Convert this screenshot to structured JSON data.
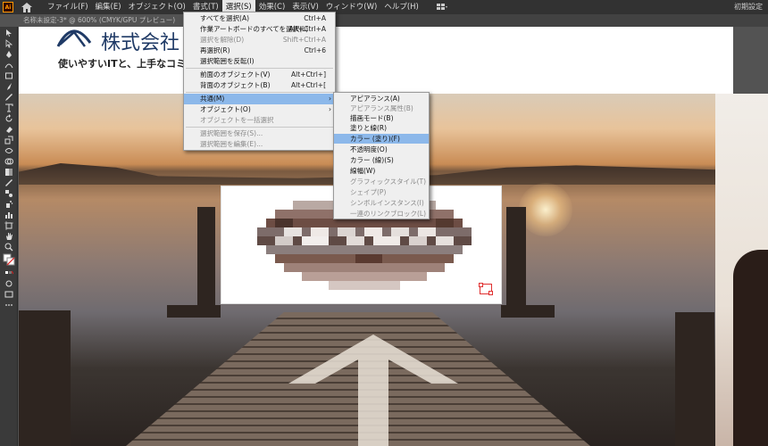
{
  "app": {
    "logo_text": "Ai",
    "workspace": "初期設定"
  },
  "menubar": {
    "items": [
      "ファイル(F)",
      "編集(E)",
      "オブジェクト(O)",
      "書式(T)",
      "選択(S)",
      "効果(C)",
      "表示(V)",
      "ウィンドウ(W)",
      "ヘルプ(H)"
    ],
    "active_index": 4
  },
  "document_tab": {
    "title": "名称未設定-3* @ 600% (CMYK/GPU プレビュー)",
    "close": "×"
  },
  "artboard": {
    "company_name": "株式会社",
    "tagline": "使いやすいITと、上手なコミュ"
  },
  "select_menu": {
    "items": [
      {
        "label": "すべてを選択(A)",
        "shortcut": "Ctrl+A",
        "disabled": false
      },
      {
        "label": "作業アートボードのすべてを選択(L)",
        "shortcut": "Alt+Ctrl+A",
        "disabled": false
      },
      {
        "label": "選択を解除(D)",
        "shortcut": "Shift+Ctrl+A",
        "disabled": true
      },
      {
        "label": "再選択(R)",
        "shortcut": "Ctrl+6",
        "disabled": false
      },
      {
        "label": "選択範囲を反転(I)",
        "shortcut": "",
        "disabled": false
      },
      {
        "label": "前面のオブジェクト(V)",
        "shortcut": "Alt+Ctrl+]",
        "disabled": false
      },
      {
        "label": "背面のオブジェクト(B)",
        "shortcut": "Alt+Ctrl+[",
        "disabled": false
      },
      {
        "label": "共通(M)",
        "shortcut": "",
        "disabled": false,
        "submenu": true
      },
      {
        "label": "オブジェクト(O)",
        "shortcut": "",
        "disabled": false,
        "submenu": true
      },
      {
        "label": "オブジェクトを一括選択",
        "shortcut": "",
        "disabled": true
      },
      {
        "label": "選択範囲を保存(S)...",
        "shortcut": "",
        "disabled": true
      },
      {
        "label": "選択範囲を編集(E)...",
        "shortcut": "",
        "disabled": true
      }
    ],
    "highlight_index": 7
  },
  "common_submenu": {
    "items": [
      {
        "label": "アピアランス(A)",
        "disabled": false
      },
      {
        "label": "アピアランス属性(B)",
        "disabled": true
      },
      {
        "label": "描画モード(B)",
        "disabled": false
      },
      {
        "label": "塗りと線(R)",
        "disabled": false
      },
      {
        "label": "カラー (塗り)(F)",
        "disabled": false
      },
      {
        "label": "不透明度(O)",
        "disabled": false
      },
      {
        "label": "カラー (線)(S)",
        "disabled": false
      },
      {
        "label": "線幅(W)",
        "disabled": false
      },
      {
        "label": "グラフィックスタイル(T)",
        "disabled": true
      },
      {
        "label": "シェイプ(P)",
        "disabled": true
      },
      {
        "label": "シンボルインスタンス(I)",
        "disabled": true
      },
      {
        "label": "一連のリンクブロック(L)",
        "disabled": true
      }
    ],
    "highlight_index": 4
  },
  "chevron": "›"
}
